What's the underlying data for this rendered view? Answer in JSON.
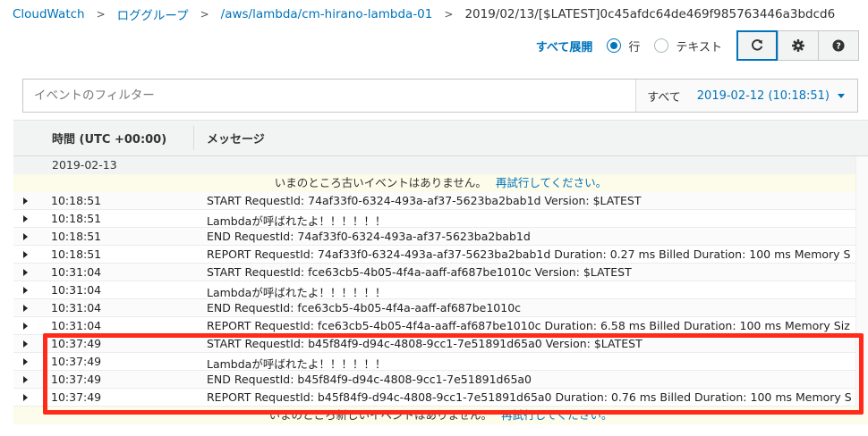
{
  "breadcrumb": {
    "items": [
      "CloudWatch",
      "ロググループ",
      "/aws/lambda/cm-hirano-lambda-01"
    ],
    "current": "2019/02/13/[$LATEST]0c45afdc64de469f985763446a3bdcd6"
  },
  "toolbar": {
    "expand_all": "すべて展開",
    "view_options": [
      {
        "label": "行",
        "selected": true
      },
      {
        "label": "テキスト",
        "selected": false
      }
    ],
    "buttons": [
      "refresh-icon",
      "gear-icon",
      "help-icon"
    ]
  },
  "filter": {
    "placeholder": "イベントのフィルター",
    "range_label": "すべて",
    "range_value": "2019-02-12 (10:18:51)"
  },
  "table": {
    "col_time": "時間 (UTC +00:00)",
    "col_message": "メッセージ",
    "date": "2019-02-13",
    "notice_old": "いまのところ古いイベントはありません。",
    "notice_new": "いまのところ新しいイベントはありません。",
    "retry": "再試行してください。",
    "rows": [
      {
        "time": "10:18:51",
        "message": "START RequestId: 74af33f0-6324-493a-af37-5623ba2bab1d Version: $LATEST"
      },
      {
        "time": "10:18:51",
        "message": "Lambdaが呼ばれたよ！！！！！！"
      },
      {
        "time": "10:18:51",
        "message": "END RequestId: 74af33f0-6324-493a-af37-5623ba2bab1d"
      },
      {
        "time": "10:18:51",
        "message": "REPORT RequestId: 74af33f0-6324-493a-af37-5623ba2bab1d Duration: 0.27 ms Billed Duration: 100 ms Memory S"
      },
      {
        "time": "10:31:04",
        "message": "START RequestId: fce63cb5-4b05-4f4a-aaff-af687be1010c Version: $LATEST"
      },
      {
        "time": "10:31:04",
        "message": "Lambdaが呼ばれたよ！！！！！！"
      },
      {
        "time": "10:31:04",
        "message": "END RequestId: fce63cb5-4b05-4f4a-aaff-af687be1010c"
      },
      {
        "time": "10:31:04",
        "message": "REPORT RequestId: fce63cb5-4b05-4f4a-aaff-af687be1010c Duration: 6.58 ms Billed Duration: 100 ms Memory Siz"
      },
      {
        "time": "10:37:49",
        "message": "START RequestId: b45f84f9-d94c-4808-9cc1-7e51891d65a0 Version: $LATEST"
      },
      {
        "time": "10:37:49",
        "message": "Lambdaが呼ばれたよ！！！！！！"
      },
      {
        "time": "10:37:49",
        "message": "END RequestId: b45f84f9-d94c-4808-9cc1-7e51891d65a0"
      },
      {
        "time": "10:37:49",
        "message": "REPORT RequestId: b45f84f9-d94c-4808-9cc1-7e51891d65a0 Duration: 0.76 ms Billed Duration: 100 ms Memory S"
      }
    ]
  },
  "colors": {
    "link": "#0073bb",
    "highlight": "#ff2a1a",
    "notice_bg": "#fdfbe9"
  }
}
